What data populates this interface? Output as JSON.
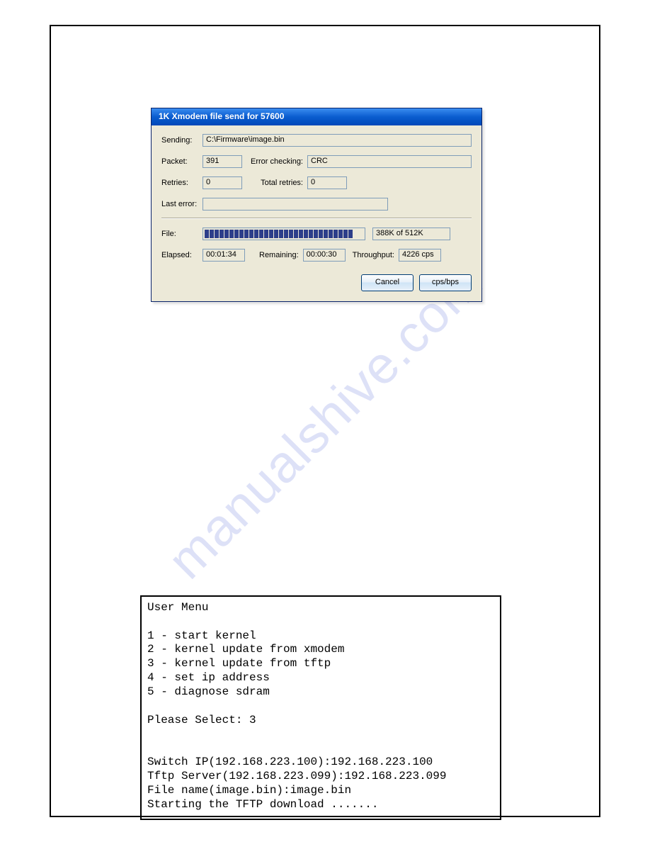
{
  "dialog": {
    "title": "1K Xmodem file send for 57600",
    "labels": {
      "sending": "Sending:",
      "packet": "Packet:",
      "error_checking": "Error checking:",
      "retries": "Retries:",
      "total_retries": "Total retries:",
      "last_error": "Last error:",
      "file": "File:",
      "elapsed": "Elapsed:",
      "remaining": "Remaining:",
      "throughput": "Throughput:"
    },
    "values": {
      "sending": "C:\\Firmware\\image.bin",
      "packet": "391",
      "error_checking": "CRC",
      "retries": "0",
      "total_retries": "0",
      "last_error": "",
      "file_progress_text": "388K of 512K",
      "elapsed": "00:01:34",
      "remaining": "00:00:30",
      "throughput": "4226 cps"
    },
    "buttons": {
      "cancel": "Cancel",
      "cpsbps": "cps/bps"
    },
    "progress_blocks": 30
  },
  "watermark": "manualshive.com",
  "terminal": "User Menu\n\n1 - start kernel\n2 - kernel update from xmodem\n3 - kernel update from tftp\n4 - set ip address\n5 - diagnose sdram\n\nPlease Select: 3\n\n\nSwitch IP(192.168.223.100):192.168.223.100\nTftp Server(192.168.223.099):192.168.223.099\nFile name(image.bin):image.bin\nStarting the TFTP download ......."
}
